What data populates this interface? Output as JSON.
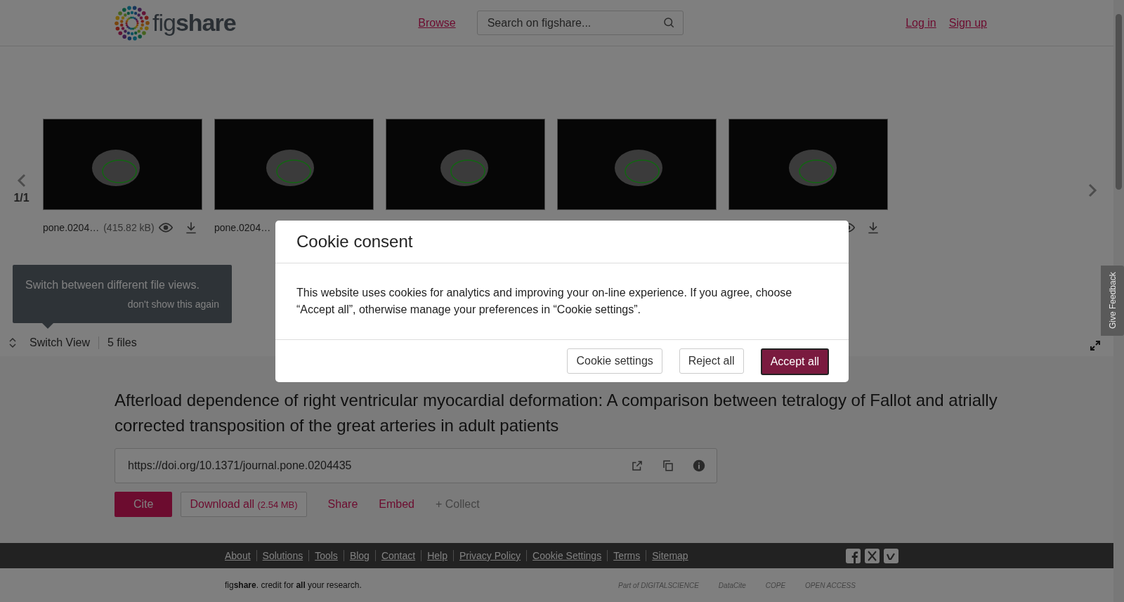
{
  "header": {
    "logo": "fig**share**",
    "nav": [
      {
        "label": "Browse"
      }
    ],
    "search": {
      "placeholder": "Search on figshare..."
    },
    "account": [
      {
        "label": "Log in"
      },
      {
        "label": "Sign up"
      }
    ]
  },
  "carousel": {
    "page": "1/1",
    "files": [
      {
        "preview": true,
        "name": "pone.0204…",
        "size": "(415.82 kB)",
        "actions": true
      },
      {
        "preview": true,
        "name": "pone.0204…"
      },
      {
        "preview": true
      },
      {
        "preview": true
      },
      {
        "preview": true,
        "actions": true
      }
    ]
  },
  "tooltip": {
    "text": "Switch between different file views.",
    "dismiss": "don't show this again"
  },
  "view_bar": {
    "switch": "Switch View",
    "count": "5 files"
  },
  "article": {
    "title": "Afterload dependence of right ventricular myocardial deformation: A comparison between tetralogy of Fallot and atrially corrected transposition of the great arteries in adult patients",
    "doi": "https://doi.org/10.1371/journal.pone.0204435",
    "actions": [
      {
        "kind": "primary",
        "label": "Cite"
      },
      {
        "kind": "outline",
        "label": "Download all",
        "extra": "(2.54 MB)"
      },
      {
        "kind": "link",
        "label": "Share"
      },
      {
        "kind": "link",
        "label": "Embed"
      },
      {
        "kind": "muted",
        "label": "+ Collect"
      }
    ]
  },
  "footer": {
    "links": [
      "About",
      "Solutions",
      "Tools",
      "Blog",
      "Contact",
      "Help",
      "Privacy Policy",
      "Cookie Settings",
      "Terms",
      "Sitemap"
    ],
    "tagline": "fig**share**. credit for **all** your research.",
    "partners": [
      "Part of DIGITALSCIENCE",
      "DataCite",
      "COPE",
      "OPEN ACCESS"
    ]
  },
  "feedback": {
    "label": "Give Feedback"
  },
  "cookie_dialog": {
    "title": "Cookie consent",
    "text": "This website uses cookies for analytics and improving your on-line experience. If you agree, choose “Accept all”, otherwise manage your preferences in “Cookie settings”.",
    "buttons": [
      {
        "label": "Cookie settings",
        "primary": false
      },
      {
        "label": "Reject all",
        "primary": false
      },
      {
        "label": "Accept all",
        "primary": true
      }
    ]
  }
}
